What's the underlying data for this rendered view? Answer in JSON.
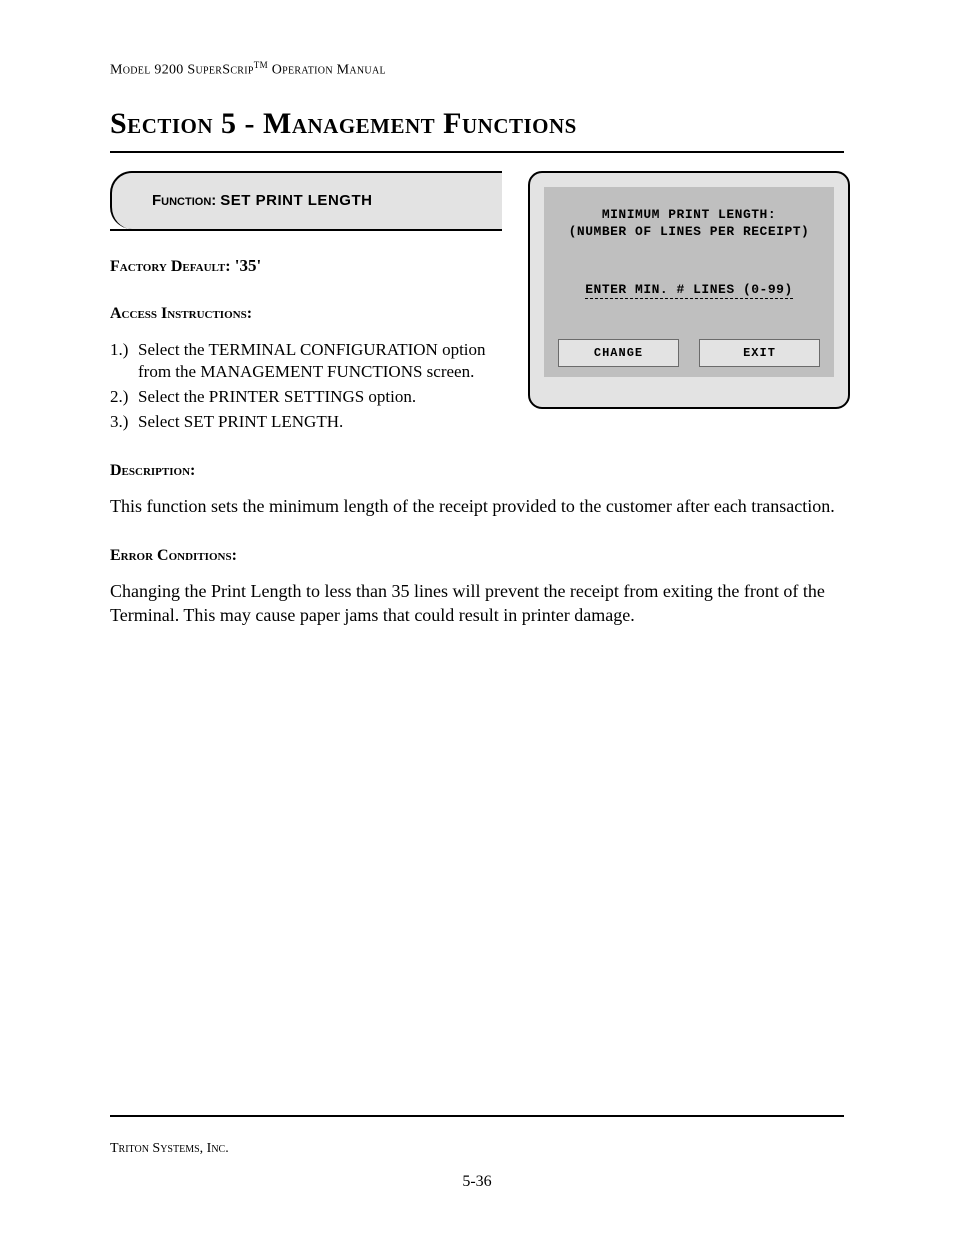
{
  "header": {
    "model": "Model 9200 SuperScrip",
    "tm": "TM",
    "tail": " Operation Manual"
  },
  "section_title": "Section 5 - Management Functions",
  "function_tab": {
    "label": "Function:",
    "name": "SET PRINT LENGTH"
  },
  "factory_default": {
    "label": "Factory Default:",
    "value": " '35'"
  },
  "access": {
    "label": "Access Instructions:",
    "items": [
      {
        "n": "1.)",
        "t": "Select the TERMINAL CONFIGURATION option from the MANAGEMENT FUNCTIONS screen."
      },
      {
        "n": "2.)",
        "t": "Select the  PRINTER SETTINGS option."
      },
      {
        "n": "3.)",
        "t": "Select SET PRINT LENGTH."
      }
    ]
  },
  "description": {
    "label": "Description:",
    "text": "This function sets the minimum length of the receipt provided to the customer after each transaction."
  },
  "error": {
    "label": "Error Conditions:",
    "text": "Changing the Print Length to less than 35 lines will prevent the receipt from exiting the front of the Terminal.  This may cause paper jams that could result in printer damage."
  },
  "screen": {
    "line1": "MINIMUM PRINT LENGTH:",
    "line2": "(NUMBER OF LINES PER RECEIPT)",
    "prompt": "ENTER MIN. # LINES (0-99)",
    "btn_change": "CHANGE",
    "btn_exit": "EXIT"
  },
  "footer": {
    "company": "Triton Systems, Inc.",
    "page": "5-36"
  }
}
